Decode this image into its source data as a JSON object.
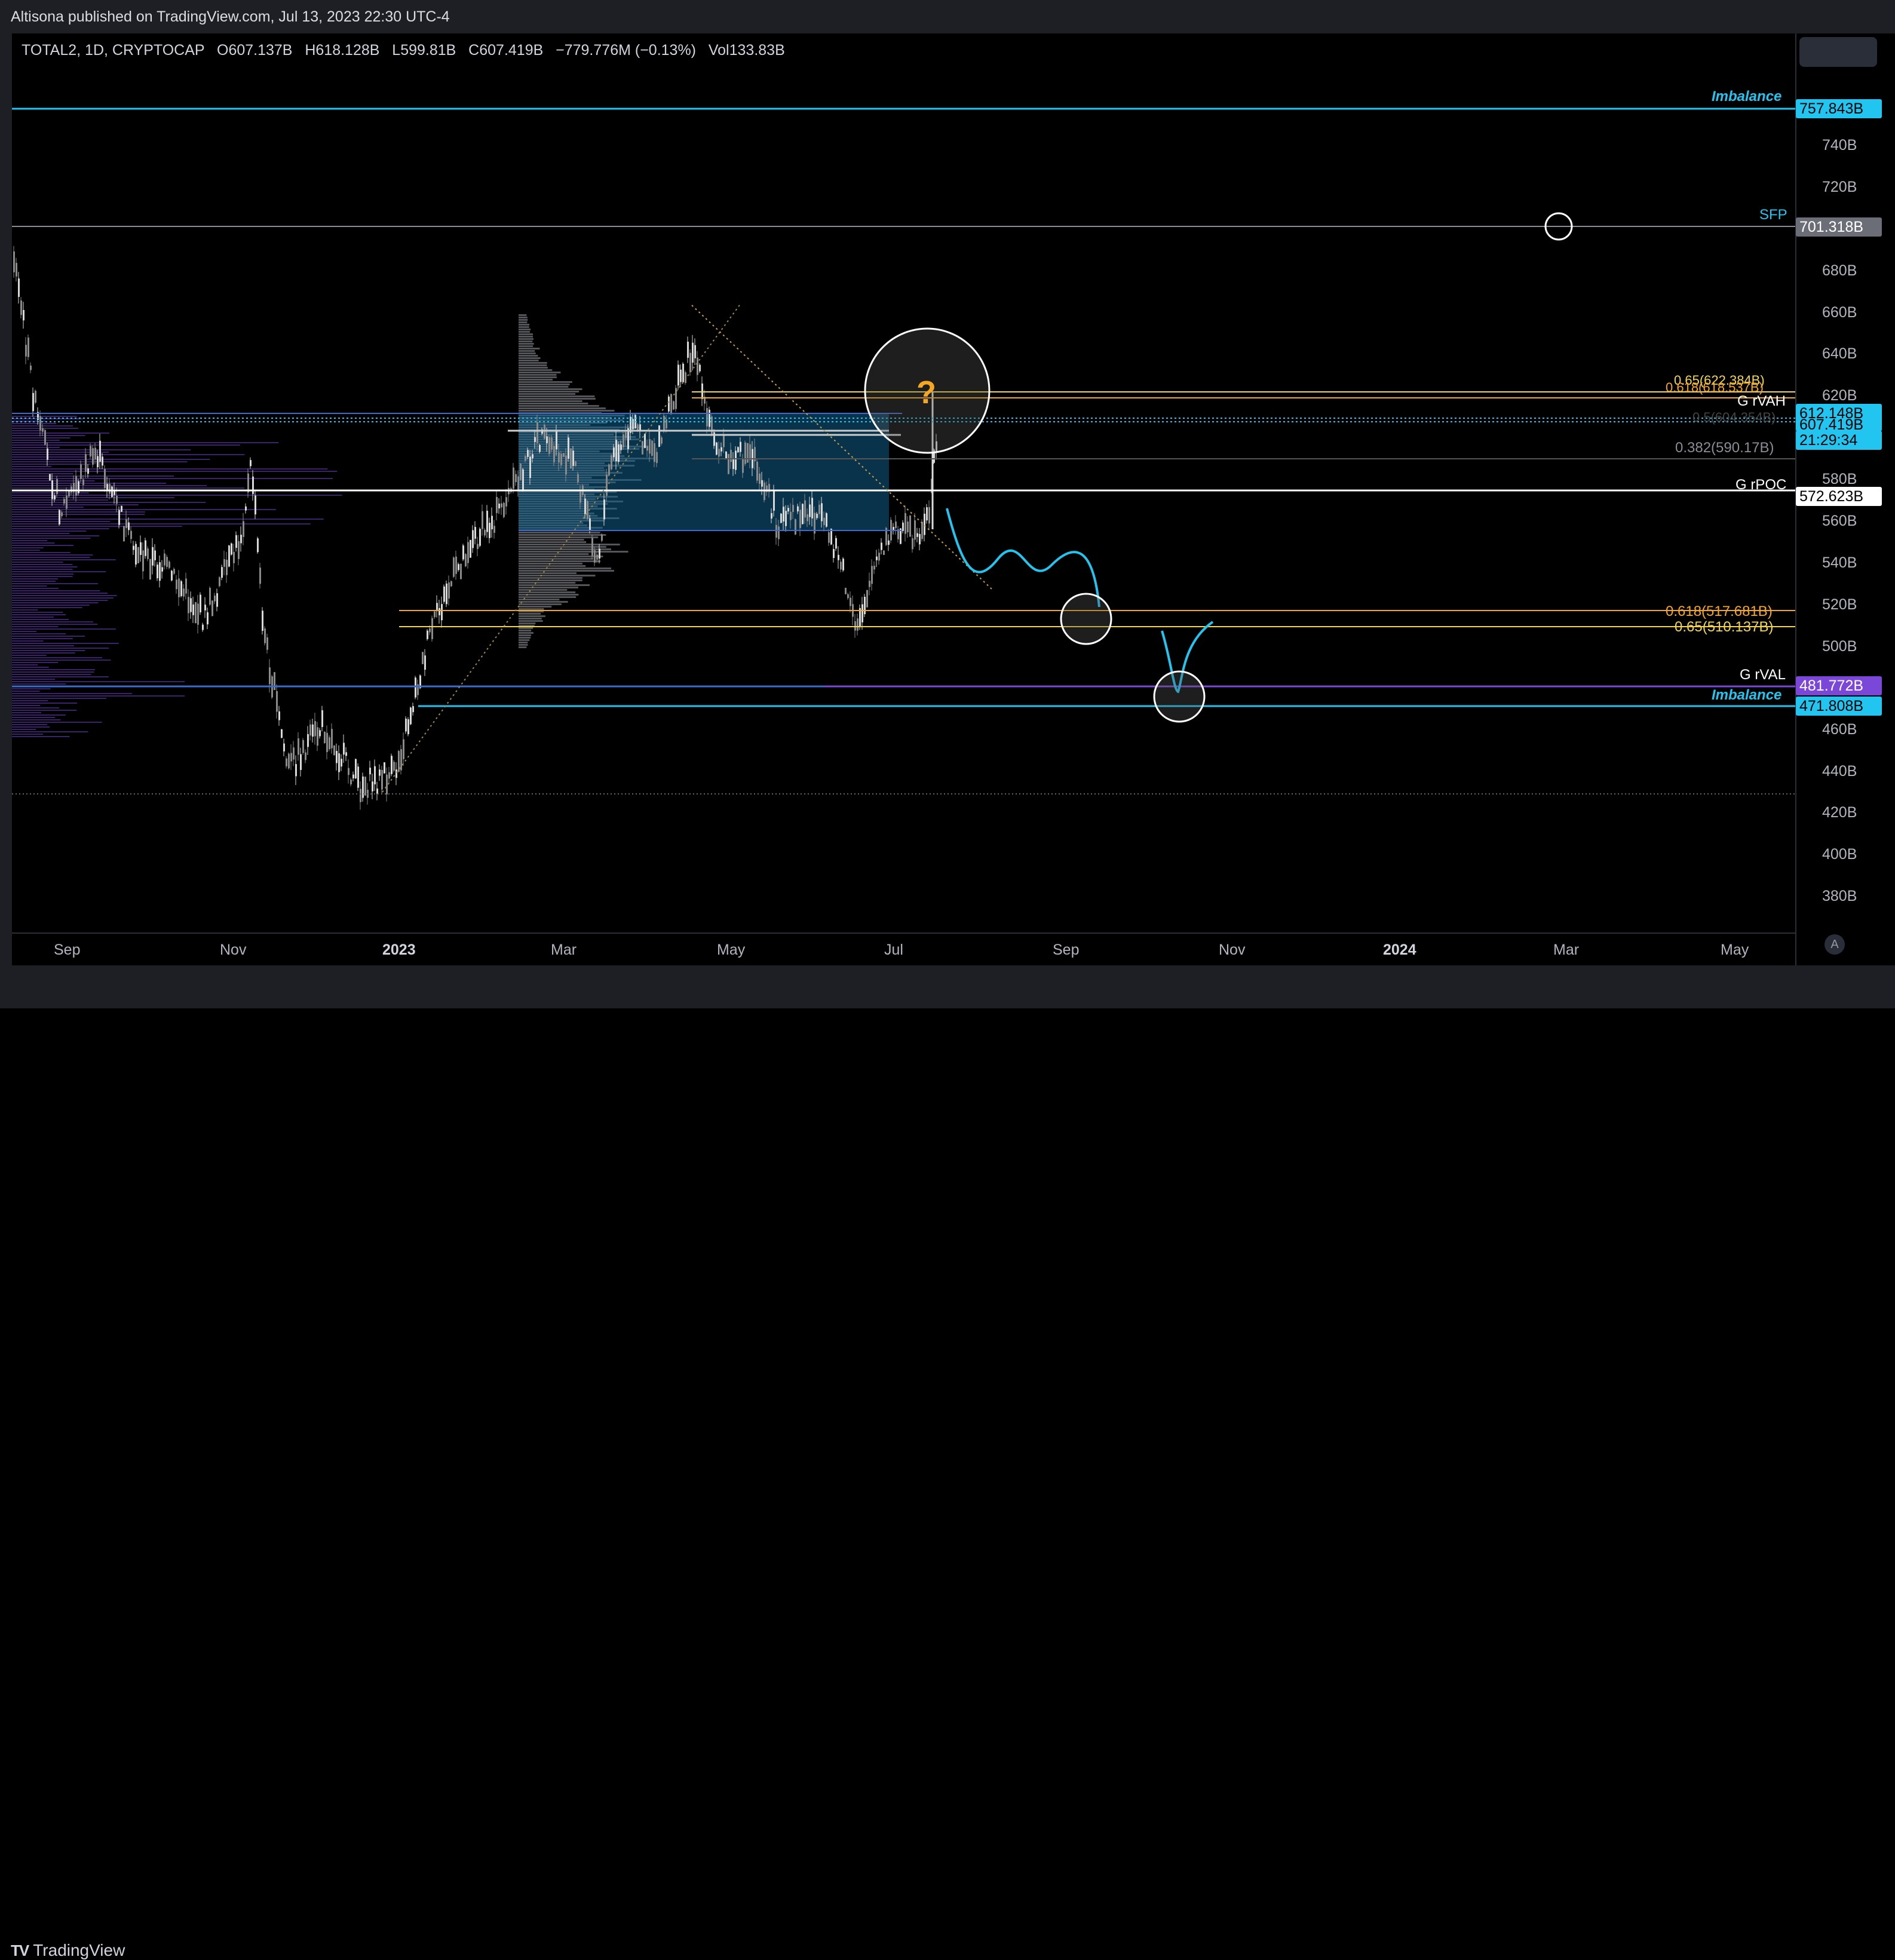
{
  "publisher_line": "Altisona published on TradingView.com, Jul 13, 2023 22:30 UTC-4",
  "symbol": {
    "title": "TOTAL2, 1D, CRYPTOCAP",
    "o_label": "O",
    "o": "607.137B",
    "h_label": "H",
    "h": "618.128B",
    "l_label": "L",
    "l": "599.81B",
    "c_label": "C",
    "c": "607.419B",
    "change": "−779.776M (−0.13%)",
    "vol_label": "Vol",
    "vol": "133.83B"
  },
  "price_scale": [
    "740B",
    "720B",
    "680B",
    "660B",
    "640B",
    "620B",
    "580B",
    "560B",
    "540B",
    "520B",
    "500B",
    "460B",
    "440B",
    "420B",
    "400B",
    "380B"
  ],
  "badges": {
    "imbalance_top": "757.843B",
    "sfp": "701.318B",
    "last_price": "612.148B",
    "close_price": "607.419B",
    "countdown": "21:29:34",
    "rpoc": "572.623B",
    "rval": "481.772B",
    "imbalance_bottom": "471.808B"
  },
  "time_axis": [
    "Sep",
    "Nov",
    "2023",
    "Mar",
    "May",
    "Jul",
    "Sep",
    "Nov",
    "2024",
    "Mar",
    "May"
  ],
  "annotations": {
    "imbalance_top": "Imbalance",
    "sfp": "SFP",
    "fib_065_top": "0.65(622.384B)",
    "fib_0618_top": "0.618(618.537B)",
    "g_rvah": "G rVAH",
    "fib_05": "0.5(604.354B)",
    "fib_0382": "0.382(590.17B)",
    "g_rpoc": "G rPOC",
    "fib_0618_bottom": "0.618(517.681B)",
    "fib_065_bottom": "0.65(510.137B)",
    "g_rval": "G rVAL",
    "imbalance_bottom": "Imbalance",
    "question_mark": "?"
  },
  "footer": {
    "brand": "TradingView",
    "auto_button": "A"
  },
  "colors": {
    "background": "#000000",
    "cyan": "#22c5f0",
    "fib_orange": "#f5a623",
    "fib_yellow": "#f3d64b",
    "purple": "#7b47d9",
    "white": "#ffffff",
    "gray_label": "#6b6e76"
  }
}
